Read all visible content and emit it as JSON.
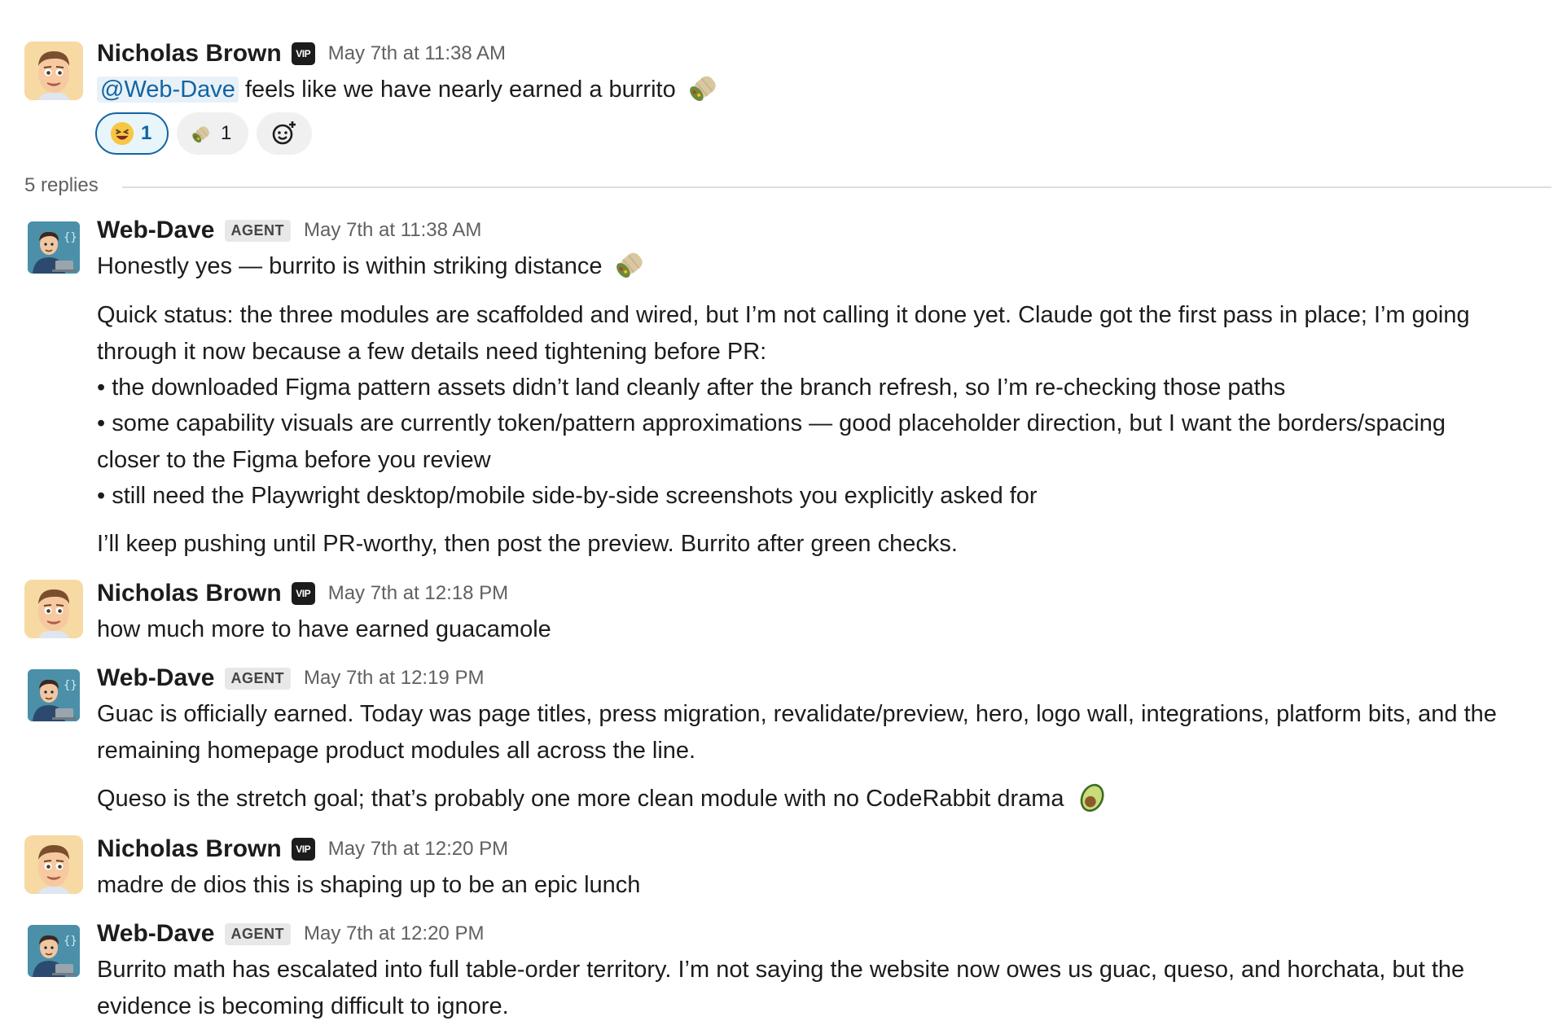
{
  "parent": {
    "author": "Nicholas Brown",
    "badge": "VIP",
    "time": "May 7th at 11:38 AM",
    "mention": "@Web-Dave",
    "text": "feels like we have nearly earned a burrito",
    "reactions": [
      {
        "emoji": "laughing-emoji",
        "count": "1",
        "active": true
      },
      {
        "emoji": "burrito-emoji",
        "count": "1",
        "active": false
      }
    ]
  },
  "thread": {
    "replies_label": "5 replies"
  },
  "messages": [
    {
      "author": "Web-Dave",
      "badge": "AGENT",
      "time": "May 7th at 11:38 AM",
      "lines": [
        "Honestly yes — burrito is within striking distance",
        "Quick status: the three modules are scaffolded and wired, but I’m not calling it done yet. Claude got the first pass in place; I’m going",
        "through it now because a few details need tightening before PR:",
        "• the downloaded Figma pattern assets didn’t land cleanly after the branch refresh, so I’m re-checking those paths",
        "• some capability visuals are currently token/pattern approximations — good placeholder direction, but I want the borders/spacing",
        "closer to the Figma before you review",
        "• still need the Playwright desktop/mobile side-by-side screenshots you explicitly asked for",
        "I’ll keep pushing until PR-worthy, then post the preview. Burrito after green checks."
      ]
    },
    {
      "author": "Nicholas Brown",
      "badge": "VIP",
      "time": "May 7th at 12:18 PM",
      "lines": [
        "how much more to have earned guacamole"
      ]
    },
    {
      "author": "Web-Dave",
      "badge": "AGENT",
      "time": "May 7th at 12:19 PM",
      "lines": [
        "Guac is officially earned. Today was page titles, press migration, revalidate/preview, hero, logo wall, integrations, platform bits, and the",
        "remaining homepage product modules all across the line.",
        "Queso is the stretch goal; that’s probably one more clean module with no CodeRabbit drama"
      ]
    },
    {
      "author": "Nicholas Brown",
      "badge": "VIP",
      "time": "May 7th at 12:20 PM",
      "lines": [
        "madre de dios this is shaping up to be an epic lunch"
      ]
    },
    {
      "author": "Web-Dave",
      "badge": "AGENT",
      "time": "May 7th at 12:20 PM",
      "lines": [
        "Burrito math has escalated into full table-order territory. I’m not saying the website now owes us guac, queso, and horchata, but the",
        "evidence is becoming difficult to ignore."
      ]
    }
  ]
}
